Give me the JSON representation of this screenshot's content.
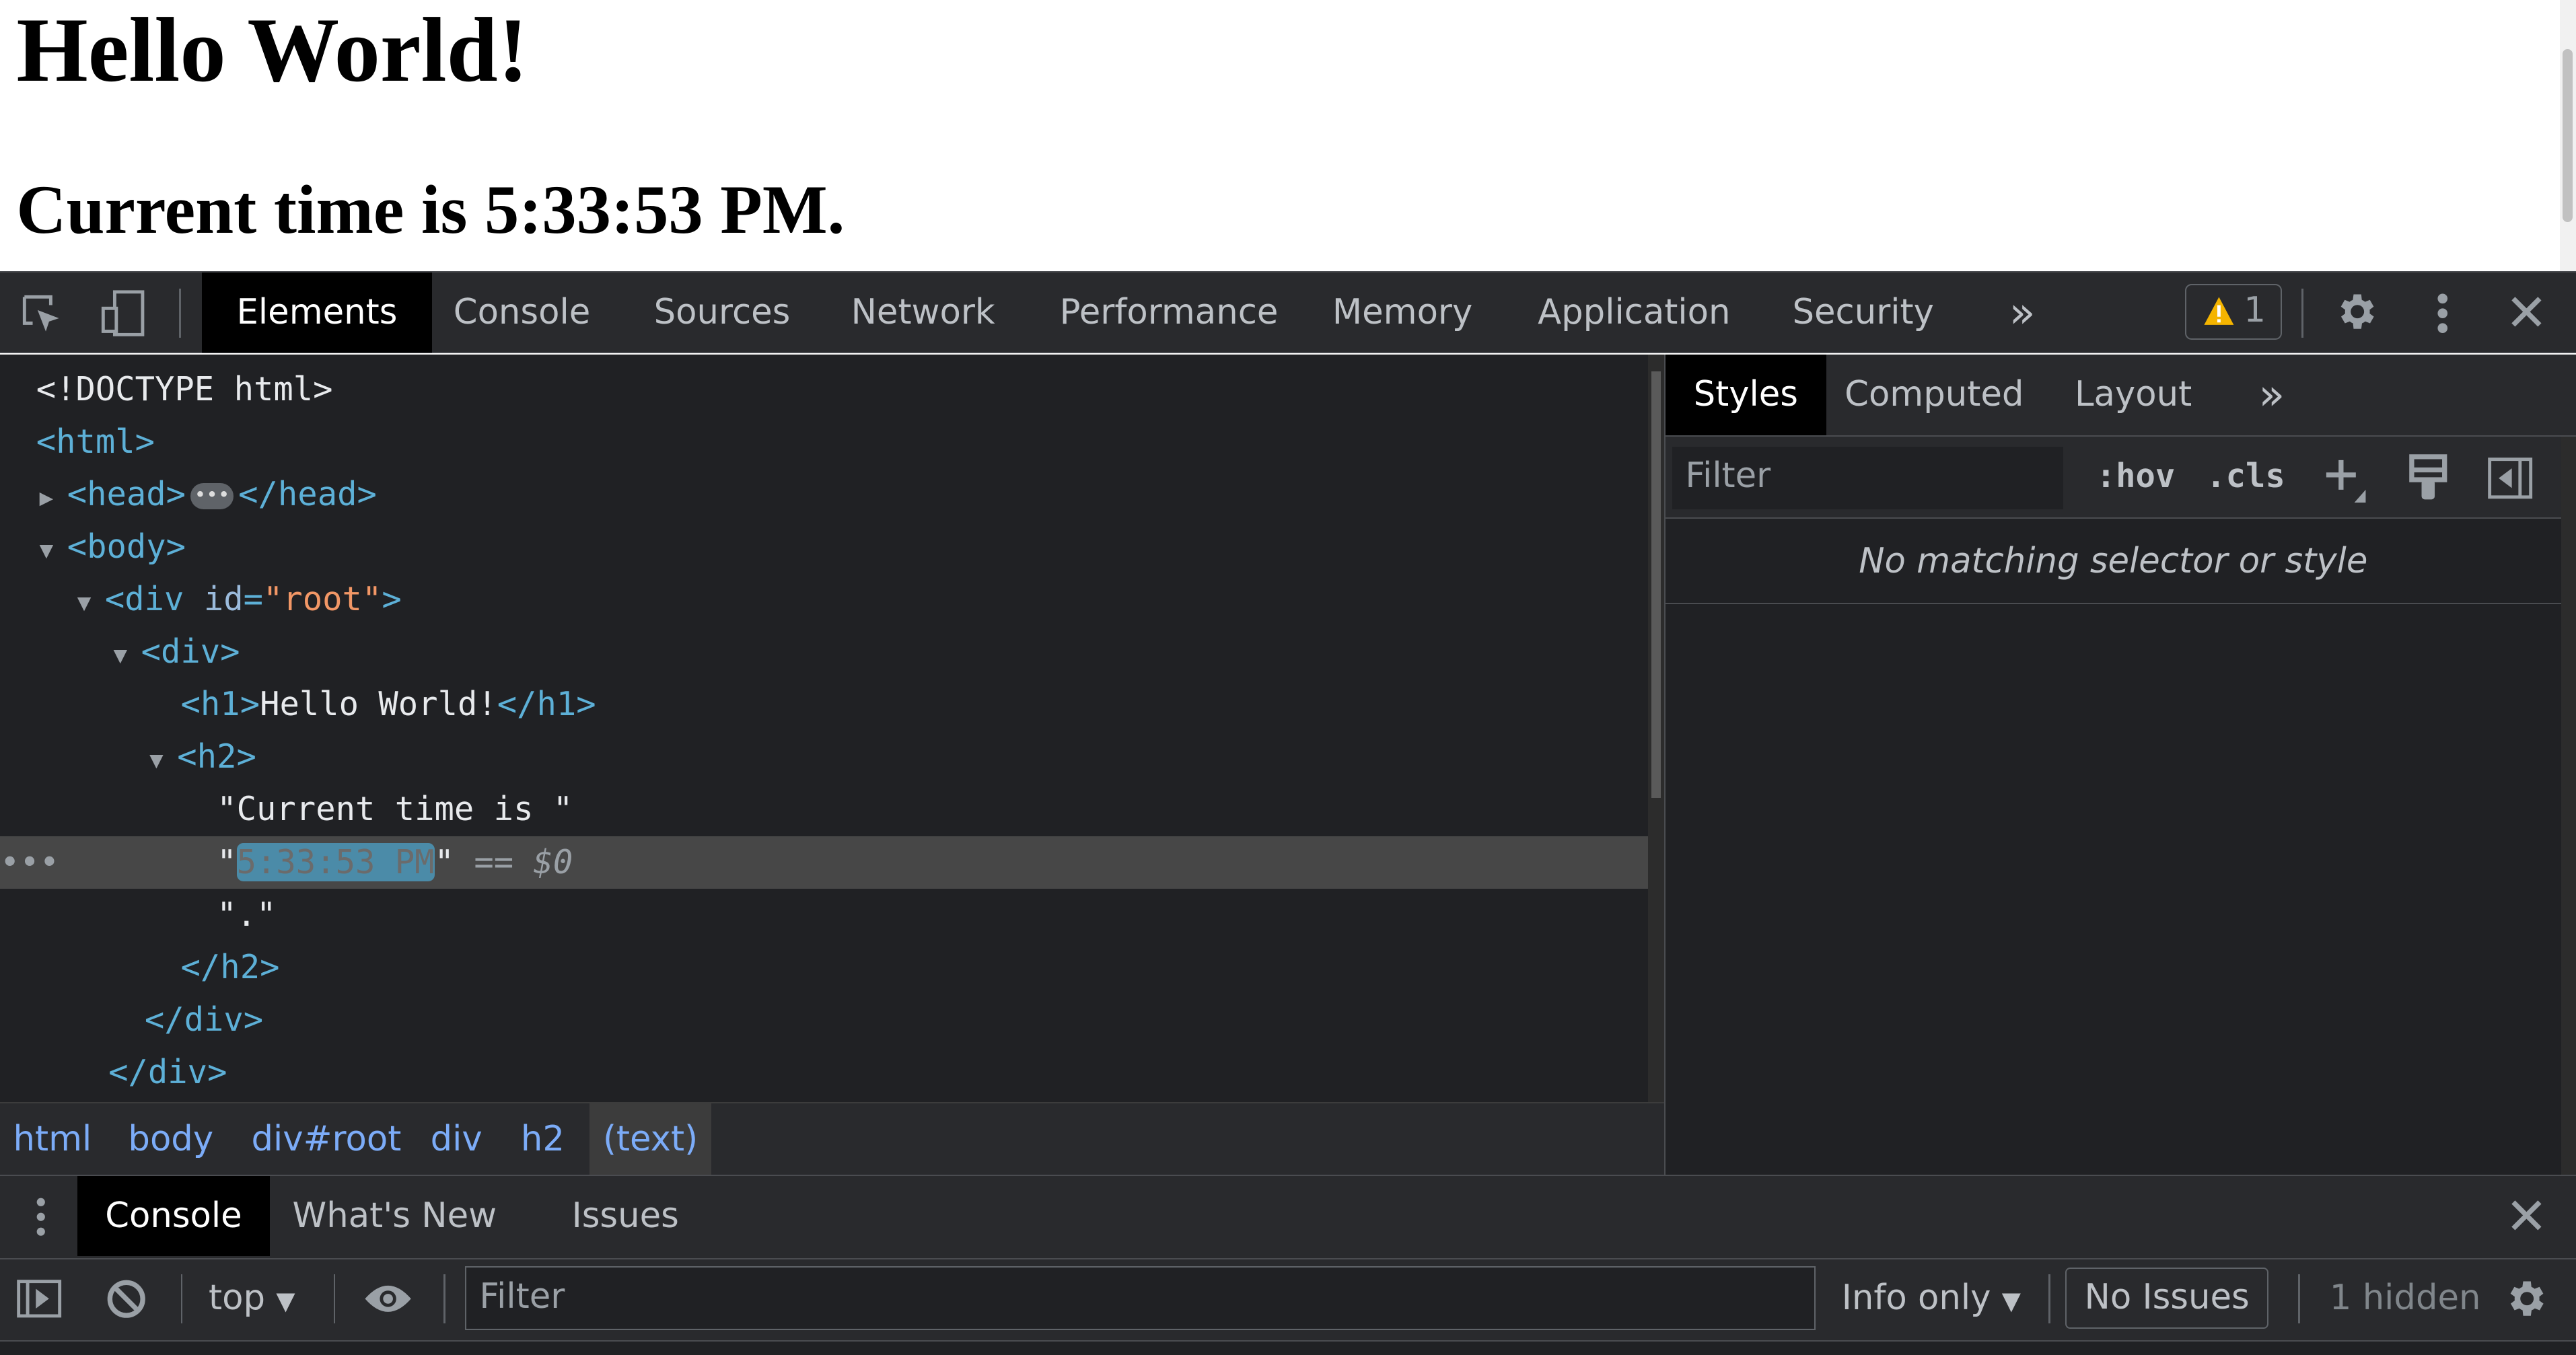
{
  "page": {
    "heading1": "Hello World!",
    "heading2": "Current time is 5:33:53 PM."
  },
  "toolbar": {
    "tabs": [
      "Elements",
      "Console",
      "Sources",
      "Network",
      "Performance",
      "Memory",
      "Application",
      "Security"
    ],
    "active_tab": "Elements",
    "more": "»",
    "warning_count": "1"
  },
  "dom_tree": {
    "lines": [
      {
        "text": "<!DOCTYPE html>"
      },
      {
        "open": "<html>"
      },
      {
        "head_open": "<head>",
        "head_close": "</head>"
      },
      {
        "open": "<body>"
      },
      {
        "div": "<div ",
        "attr": "id",
        "val": "\"root\"",
        "end": ">"
      },
      {
        "open": "<div>"
      },
      {
        "h1o": "<h1>",
        "txt": "Hello World!",
        "h1c": "</h1>"
      },
      {
        "open": "<h2>"
      },
      {
        "text": "\"Current time is \""
      },
      {
        "q1": "\"",
        "value": "5:33:53 PM",
        "q2": "\"",
        "ref": "== $0"
      },
      {
        "text": "\".\""
      },
      {
        "close": "</h2>"
      },
      {
        "close": "</div>"
      },
      {
        "close": "</div>"
      }
    ]
  },
  "breadcrumb": [
    "html",
    "body",
    "div#root",
    "div",
    "h2",
    "(text)"
  ],
  "styles": {
    "tabs": [
      "Styles",
      "Computed",
      "Layout"
    ],
    "more": "»",
    "filter_placeholder": "Filter",
    "hov": ":hov",
    "cls": ".cls",
    "empty_message": "No matching selector or style"
  },
  "drawer": {
    "tabs": [
      "Console",
      "What's New",
      "Issues"
    ],
    "active_tab": "Console",
    "context": "top",
    "filter_placeholder": "Filter",
    "level": "Info only",
    "issues": "No Issues",
    "hidden": "1 hidden"
  },
  "colors": {
    "tag": "#5db0d7",
    "attr_value": "#f29766",
    "warning": "#f4b400",
    "selection": "#4b8ba8"
  }
}
